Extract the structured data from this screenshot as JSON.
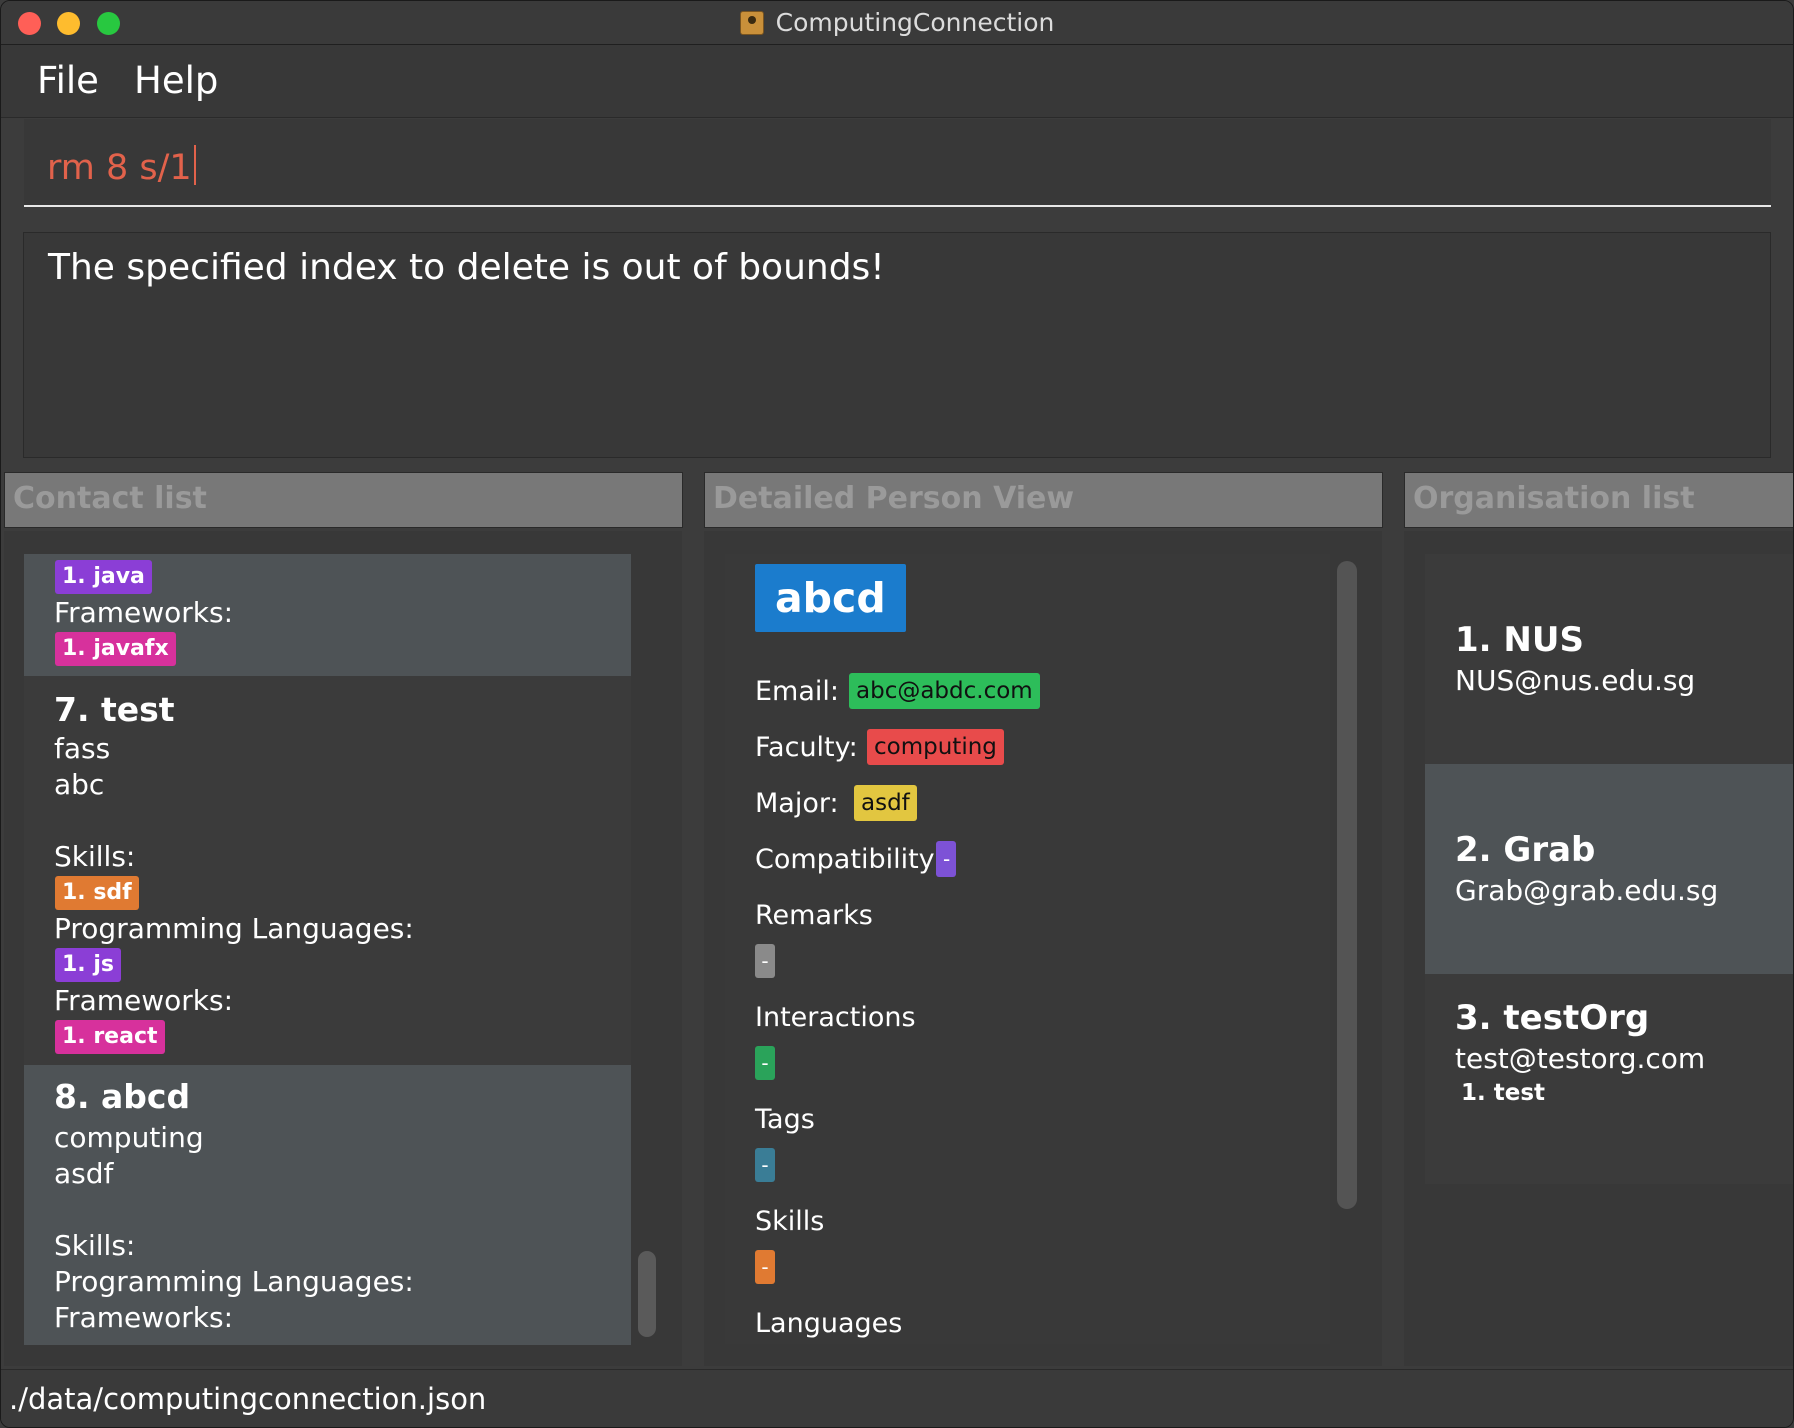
{
  "window": {
    "title": "ComputingConnection"
  },
  "menu": {
    "file": "File",
    "help": "Help"
  },
  "command": {
    "value": "rm 8 s/1"
  },
  "result": {
    "message": "The specified index to delete is out of bounds!"
  },
  "panels": {
    "contact_list": "Contact list",
    "detail_view": "Detailed Person View",
    "org_list": "Organisation list"
  },
  "contacts": {
    "partial": {
      "language_tag": "1. java",
      "frameworks_label": "Frameworks:",
      "framework_tag": "1. javafx"
    },
    "c7": {
      "index_name": "7.  test",
      "faculty": "fass",
      "major": "abc",
      "skills_label": "Skills:",
      "skill_tag": "1. sdf",
      "languages_label": "Programming Languages:",
      "language_tag": "1. js",
      "frameworks_label": "Frameworks:",
      "framework_tag": "1. react"
    },
    "c8": {
      "index_name": "8.  abcd",
      "faculty": "computing",
      "major": "asdf",
      "skills_label": "Skills:",
      "languages_label": "Programming Languages:",
      "frameworks_label": "Frameworks:"
    }
  },
  "detail": {
    "name": "abcd",
    "email_label": "Email:",
    "email": "abc@abdc.com",
    "faculty_label": "Faculty:",
    "faculty": "computing",
    "major_label": "Major:",
    "major": "asdf",
    "compat_label": "Compatibility",
    "compat": "-",
    "remarks_label": "Remarks",
    "remarks": "-",
    "interactions_label": "Interactions",
    "interactions": "-",
    "tags_label": "Tags",
    "tags": "-",
    "skills_label": "Skills",
    "skills": "-",
    "languages_label": "Languages"
  },
  "organisations": [
    {
      "index_name": "1.  NUS",
      "email": "NUS@nus.edu.sg"
    },
    {
      "index_name": "2.  Grab",
      "email": "Grab@grab.edu.sg"
    },
    {
      "index_name": "3.  testOrg",
      "email": "test@testorg.com",
      "tag": "1. test"
    }
  ],
  "status": {
    "path": "./data/computingconnection.json"
  },
  "colors": {
    "accent_blue": "#1b7ccd",
    "email_green": "#2dbd5a",
    "faculty_red": "#e84b4b",
    "major_yellow": "#e2c640",
    "compat_purple": "#7d52d6",
    "command_text": "#e2624b"
  }
}
